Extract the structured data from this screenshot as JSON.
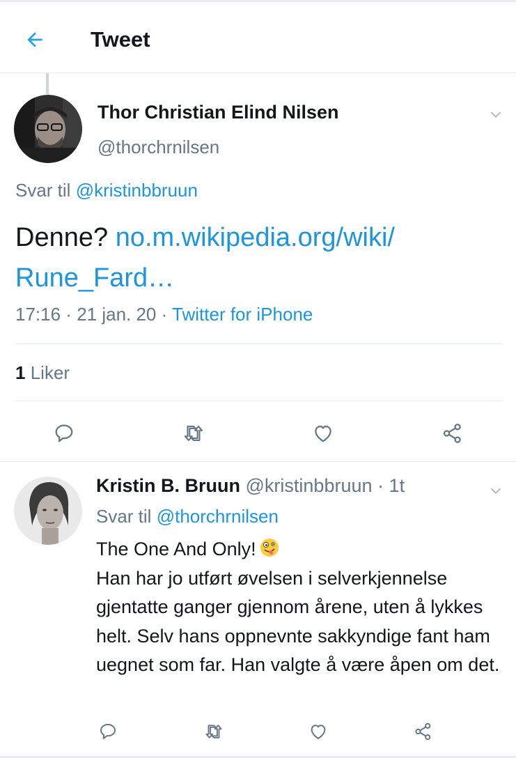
{
  "header": {
    "title": "Tweet",
    "back_icon": "arrow-left-icon",
    "accent_color": "#1da1f2"
  },
  "main_tweet": {
    "author_name": "Thor Christian Elind Nilsen",
    "author_handle": "@thorchrnilsen",
    "reply_prefix": "Svar til",
    "reply_to": "@kristinbbruun",
    "text_plain": "Denne?",
    "text_link_line1": "no.m.wikipedia.org/wiki/",
    "text_link_line2": "Rune_Fard…",
    "time": "17:16",
    "date": "21 jan. 20",
    "source": "Twitter for iPhone",
    "like_count": "1",
    "like_label": "Liker",
    "actions": [
      "reply-icon",
      "retweet-icon",
      "heart-icon",
      "share-icon"
    ]
  },
  "reply_tweet": {
    "author_name": "Kristin B. Bruun",
    "author_handle": "@kristinbbruun",
    "age": "1t",
    "reply_prefix": "Svar til",
    "reply_to": "@thorchrnilsen",
    "line1": "The One And Only!",
    "emoji": "zany-face-emoji",
    "body": "Han har jo utført øvelsen i selverkjennelse gjentatte ganger gjennom årene, uten å lykkes helt. Selv hans oppnevnte sakkyndige fant ham uegnet som far. Han valgte å være åpen om det.",
    "actions": [
      "reply-icon",
      "retweet-icon",
      "heart-icon",
      "share-icon"
    ]
  },
  "colors": {
    "link": "#1b95e0",
    "secondary_text": "#657786",
    "divider": "#e6ecf0"
  }
}
